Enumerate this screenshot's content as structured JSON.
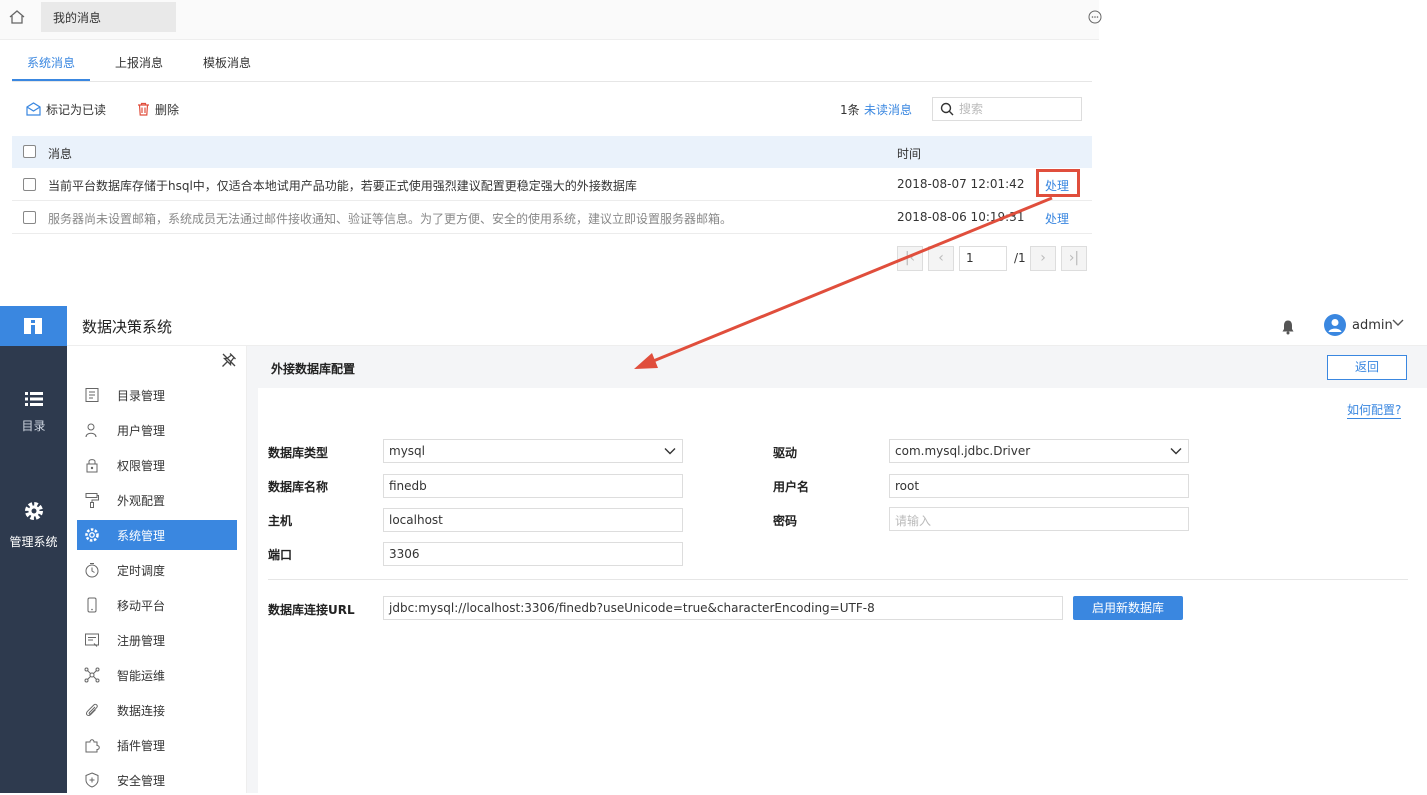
{
  "top": {
    "page_tab": "我的消息",
    "tabs": [
      "系统消息",
      "上报消息",
      "模板消息"
    ],
    "mark_read": "标记为已读",
    "delete": "删除",
    "unread_count": "1条",
    "unread_label": "未读消息",
    "search_placeholder": "搜索",
    "col_message": "消息",
    "col_time": "时间",
    "rows": [
      {
        "message": "当前平台数据库存储于hsql中，仅适合本地试用产品功能，若要正式使用强烈建议配置更稳定强大的外接数据库",
        "time": "2018-08-07 12:01:42",
        "action": "处理"
      },
      {
        "message": "服务器尚未设置邮箱，系统成员无法通过邮件接收通知、验证等信息。为了更方便、安全的使用系统，建议立即设置服务器邮箱。",
        "time": "2018-08-06 10:19:31",
        "action": "处理"
      }
    ],
    "page_current": "1",
    "page_total": "/1"
  },
  "app": {
    "title": "数据决策系统",
    "user": "admin",
    "rail": [
      "目录",
      "管理系统"
    ],
    "menu": [
      "目录管理",
      "用户管理",
      "权限管理",
      "外观配置",
      "系统管理",
      "定时调度",
      "移动平台",
      "注册管理",
      "智能运维",
      "数据连接",
      "插件管理",
      "安全管理"
    ],
    "active_menu": "系统管理",
    "content_title": "外接数据库配置",
    "back": "返回",
    "how_to": "如何配置?",
    "form": {
      "db_type_label": "数据库类型",
      "db_type": "mysql",
      "driver_label": "驱动",
      "driver": "com.mysql.jdbc.Driver",
      "db_name_label": "数据库名称",
      "db_name": "finedb",
      "username_label": "用户名",
      "username": "root",
      "host_label": "主机",
      "host": "localhost",
      "password_label": "密码",
      "password_placeholder": "请输入",
      "port_label": "端口",
      "port": "3306",
      "url_label": "数据库连接URL",
      "url": "jdbc:mysql://localhost:3306/finedb?useUnicode=true&characterEncoding=UTF-8",
      "enable_button": "启用新数据库"
    }
  },
  "colors": {
    "accent": "#3a87e0",
    "highlight": "#e04e3c",
    "rail": "#2e3a4e"
  }
}
